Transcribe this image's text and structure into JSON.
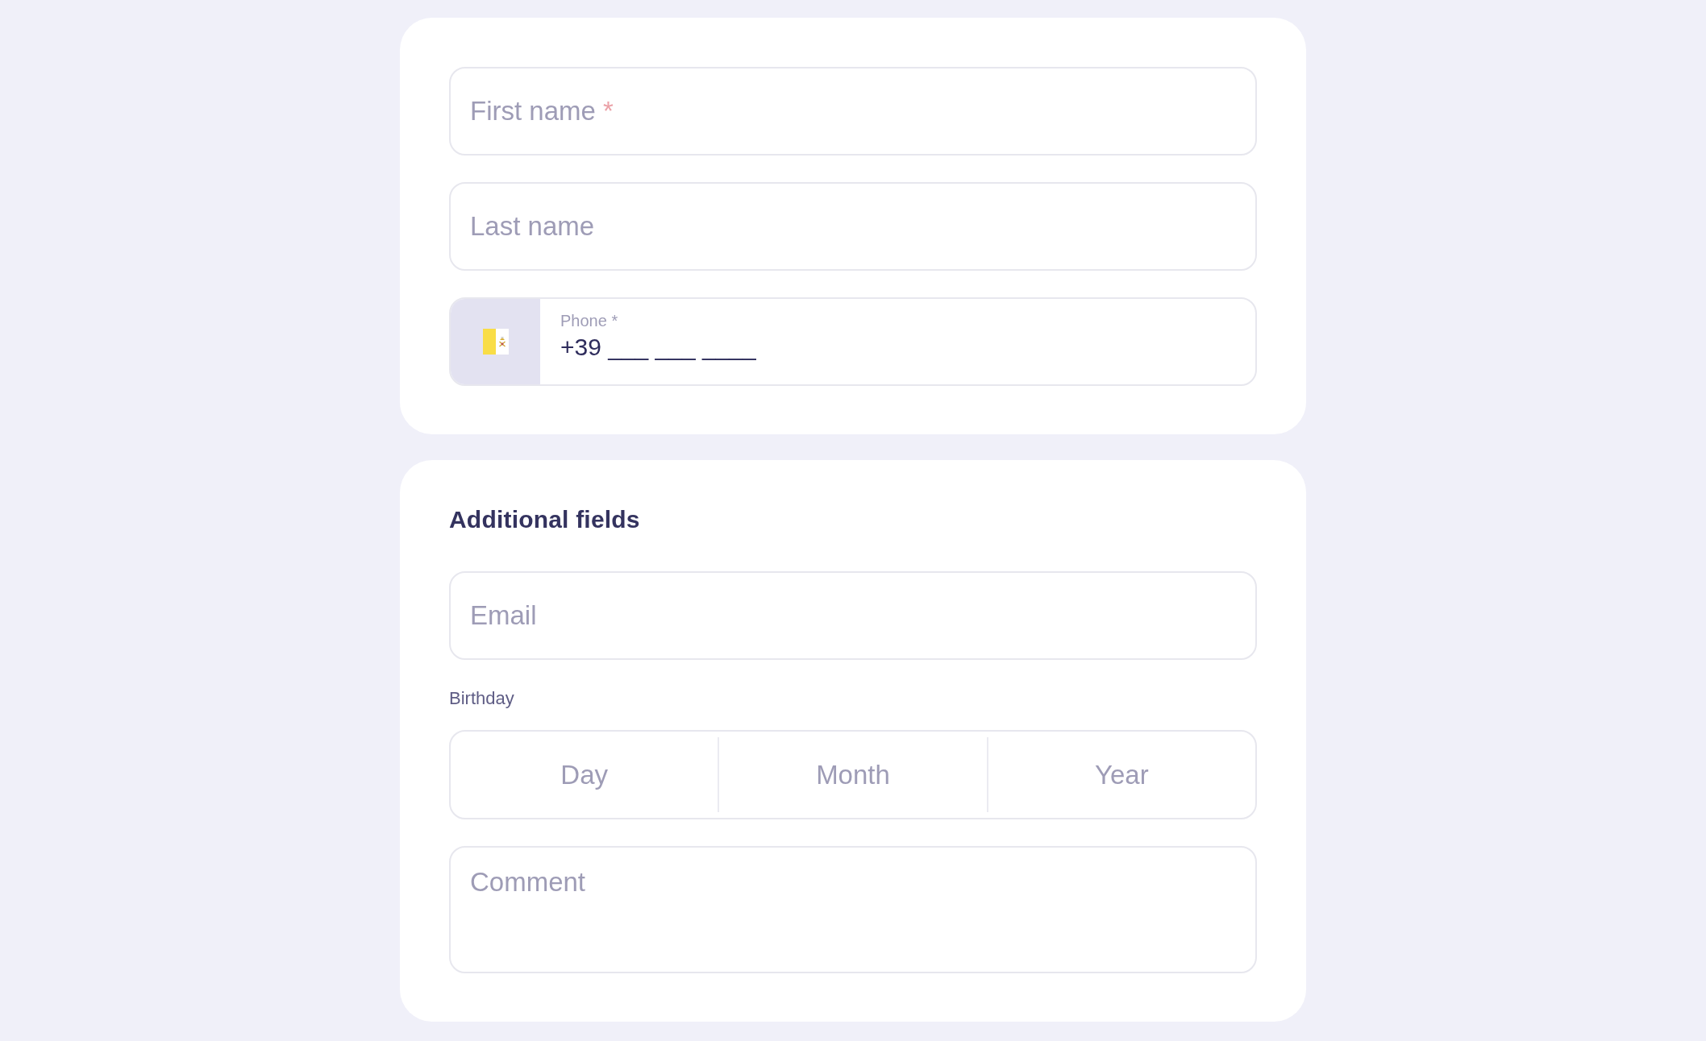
{
  "contact_card": {
    "fields": [
      {
        "kind": "text",
        "placeholder": "First name",
        "required_mark": "*"
      },
      {
        "kind": "text",
        "placeholder": "Last name"
      },
      {
        "kind": "phone",
        "label": "Phone *",
        "value": "+39 ___ ___ ____"
      }
    ]
  },
  "additional_card": {
    "title": "Additional fields",
    "fields": [
      {
        "kind": "text",
        "placeholder": "Email"
      },
      {
        "kind": "date",
        "label": "Birthday",
        "parts": [
          {
            "placeholder": "Day"
          },
          {
            "placeholder": "Month"
          },
          {
            "placeholder": "Year"
          }
        ]
      },
      {
        "kind": "textarea",
        "placeholder": "Comment"
      }
    ]
  }
}
